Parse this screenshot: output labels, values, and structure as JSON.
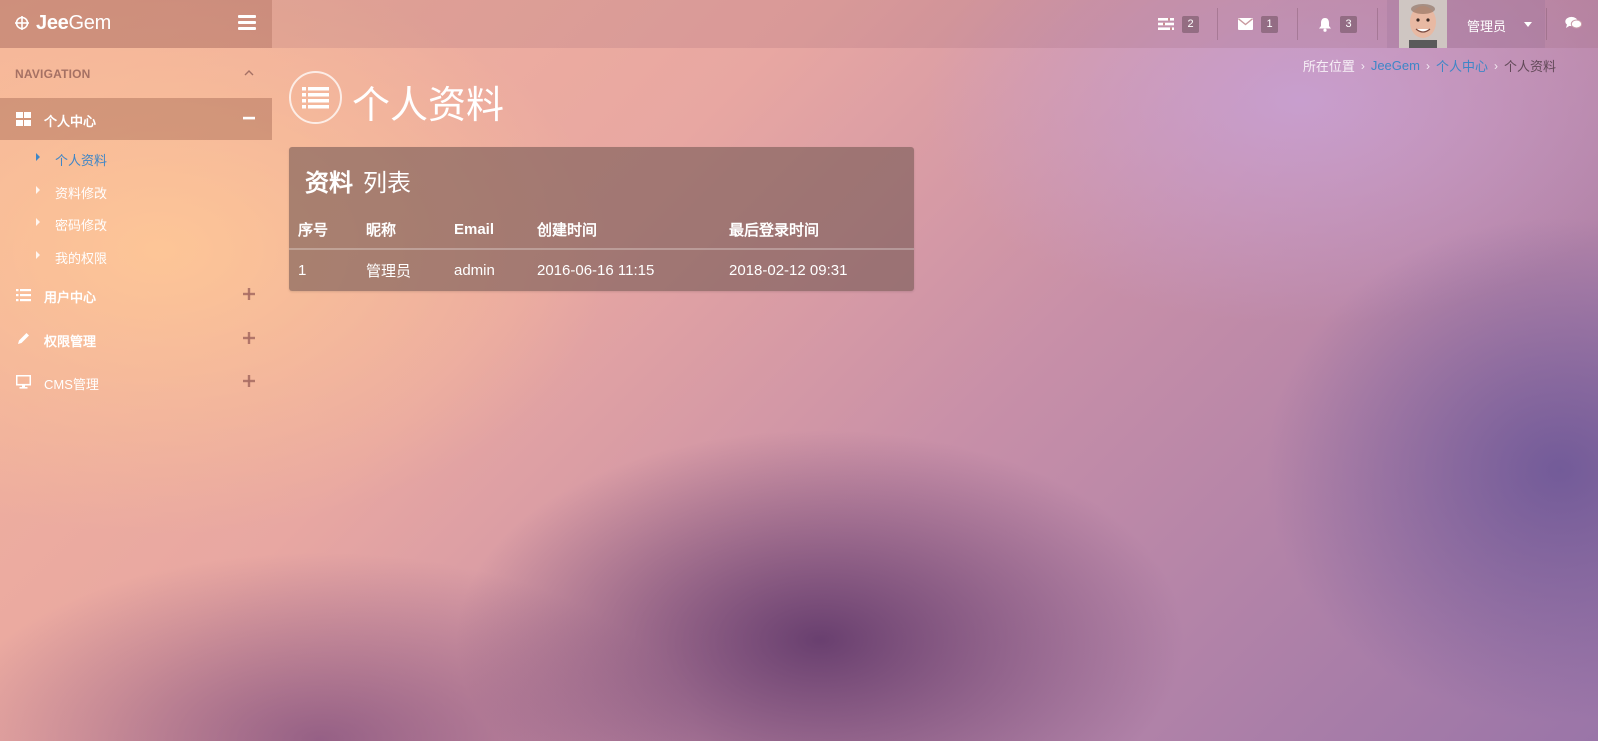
{
  "brand": {
    "name_bold": "Jee",
    "name_rest": "Gem"
  },
  "header": {
    "tasks": {
      "icon": "tasks-icon",
      "count": "2"
    },
    "messages": {
      "icon": "envelope-icon",
      "count": "1"
    },
    "notifications": {
      "icon": "bell-icon",
      "count": "3"
    },
    "user": {
      "name": "管理员"
    }
  },
  "sidebar": {
    "title": "NAVIGATION",
    "groups": [
      {
        "label": "个人中心",
        "icon": "dashboard-icon",
        "expanded": true,
        "items": [
          {
            "label": "个人资料",
            "active": true
          },
          {
            "label": "资料修改"
          },
          {
            "label": "密码修改"
          },
          {
            "label": "我的权限"
          }
        ]
      },
      {
        "label": "用户中心",
        "icon": "list-icon",
        "expanded": false
      },
      {
        "label": "权限管理",
        "icon": "pencil-icon",
        "expanded": false
      },
      {
        "label": "CMS管理",
        "icon": "monitor-icon",
        "expanded": false
      }
    ]
  },
  "page": {
    "title": "个人资料"
  },
  "breadcrumb": {
    "prefix": "所在位置",
    "items": [
      "JeeGem",
      "个人中心"
    ],
    "current": "个人资料"
  },
  "panel": {
    "title_strong": "资料",
    "title_light": "列表",
    "columns": [
      "序号",
      "昵称",
      "Email",
      "创建时间",
      "最后登录时间"
    ],
    "rows": [
      [
        "1",
        "管理员",
        "admin",
        "2016-06-16 11:15",
        "2018-02-12 09:31"
      ]
    ]
  },
  "colors": {
    "accent_link": "#3e86c7"
  }
}
